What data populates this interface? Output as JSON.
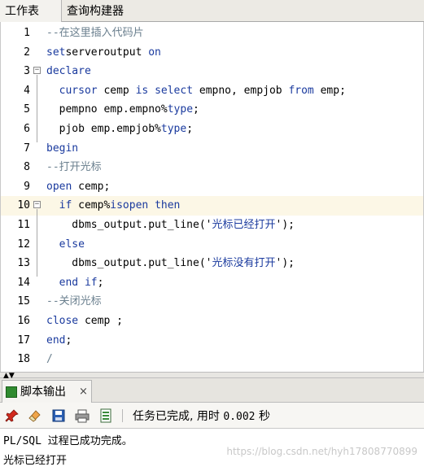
{
  "tabs": {
    "worksheet": "工作表",
    "query_builder": "查询构建器"
  },
  "editor": {
    "lines": [
      {
        "n": "1",
        "parts": [
          [
            "cm",
            "--在这里插入代码片"
          ]
        ]
      },
      {
        "n": "2",
        "parts": [
          [
            "kw",
            "set"
          ],
          [
            "",
            "serveroutput "
          ],
          [
            "kw",
            "on"
          ]
        ]
      },
      {
        "n": "3",
        "parts": [
          [
            "kw",
            "declare"
          ]
        ]
      },
      {
        "n": "4",
        "parts": [
          [
            "",
            "  "
          ],
          [
            "kw",
            "cursor"
          ],
          [
            "",
            " cemp "
          ],
          [
            "kw",
            "is"
          ],
          [
            "",
            " "
          ],
          [
            "kw",
            "select"
          ],
          [
            "",
            " empno, empjob "
          ],
          [
            "kw",
            "from"
          ],
          [
            "",
            " emp;"
          ]
        ]
      },
      {
        "n": "5",
        "parts": [
          [
            "",
            "  pempno emp.empno%"
          ],
          [
            "kw",
            "type"
          ],
          [
            "",
            ";"
          ]
        ]
      },
      {
        "n": "6",
        "parts": [
          [
            "",
            "  pjob emp.empjob%"
          ],
          [
            "kw",
            "type"
          ],
          [
            "",
            ";"
          ]
        ]
      },
      {
        "n": "7",
        "parts": [
          [
            "kw",
            "begin"
          ]
        ]
      },
      {
        "n": "8",
        "parts": [
          [
            "cm",
            "--打开光标"
          ]
        ]
      },
      {
        "n": "9",
        "parts": [
          [
            "kw",
            "open"
          ],
          [
            "",
            " cemp;"
          ]
        ]
      },
      {
        "n": "10",
        "parts": [
          [
            "",
            "  "
          ],
          [
            "kw",
            "if"
          ],
          [
            "",
            " cemp%"
          ],
          [
            "kw",
            "isopen"
          ],
          [
            "",
            " "
          ],
          [
            "kw",
            "then"
          ]
        ]
      },
      {
        "n": "11",
        "parts": [
          [
            "",
            "    dbms_output.put_line('"
          ],
          [
            "str",
            "光标已经打开"
          ],
          [
            "",
            "');"
          ]
        ]
      },
      {
        "n": "12",
        "parts": [
          [
            "",
            "  "
          ],
          [
            "kw",
            "else"
          ]
        ]
      },
      {
        "n": "13",
        "parts": [
          [
            "",
            "    dbms_output.put_line('"
          ],
          [
            "str",
            "光标没有打开"
          ],
          [
            "",
            "');"
          ]
        ]
      },
      {
        "n": "14",
        "parts": [
          [
            "",
            "  "
          ],
          [
            "kw",
            "end if"
          ],
          [
            "",
            ";"
          ]
        ]
      },
      {
        "n": "15",
        "parts": [
          [
            "cm",
            "--关闭光标"
          ]
        ]
      },
      {
        "n": "16",
        "parts": [
          [
            "kw",
            "close"
          ],
          [
            "",
            " cemp ;"
          ]
        ]
      },
      {
        "n": "17",
        "parts": [
          [
            "kw",
            "end"
          ],
          [
            "",
            ";"
          ]
        ]
      },
      {
        "n": "18",
        "parts": [
          [
            "cm",
            "/"
          ]
        ]
      }
    ],
    "highlighted_line": "10"
  },
  "output_panel": {
    "tab_label": "脚本输出",
    "close_glyph": "×",
    "status_prefix": "任务已完成,  用时 ",
    "status_time": "0.002",
    "status_unit": " 秒",
    "icons": [
      "pin-icon",
      "eraser-icon",
      "save-icon",
      "print-icon",
      "document-icon"
    ],
    "output_lines": [
      "PL/SQL 过程已成功完成。",
      "光标已经打开"
    ]
  },
  "watermark": "https://blog.csdn.net/hyh17808770899",
  "colors": {
    "keyword": "#1a3a9e",
    "comment": "#6a7f8e",
    "highlight": "#fcf7e6"
  }
}
